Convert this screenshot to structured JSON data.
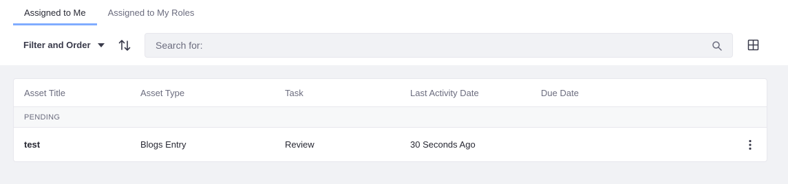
{
  "tabs": [
    {
      "label": "Assigned to Me",
      "active": true
    },
    {
      "label": "Assigned to My Roles",
      "active": false
    }
  ],
  "toolbar": {
    "filter_label": "Filter and Order",
    "search_placeholder": "Search for:"
  },
  "table": {
    "columns": [
      "Asset Title",
      "Asset Type",
      "Task",
      "Last Activity Date",
      "Due Date"
    ],
    "group_label": "PENDING",
    "rows": [
      {
        "asset_title": "test",
        "asset_type": "Blogs Entry",
        "task": "Review",
        "last_activity": "30 Seconds Ago",
        "due_date": ""
      }
    ]
  },
  "icons": {
    "sort": "sort-icon",
    "search": "search-icon",
    "view": "grid-view-icon",
    "actions": "ellipsis-vertical-icon",
    "filter_caret": "caret-down-icon"
  },
  "colors": {
    "accent": "#80acff",
    "text": "#272833",
    "secondary_text": "#6b6c7e",
    "background": "#f1f2f5"
  }
}
